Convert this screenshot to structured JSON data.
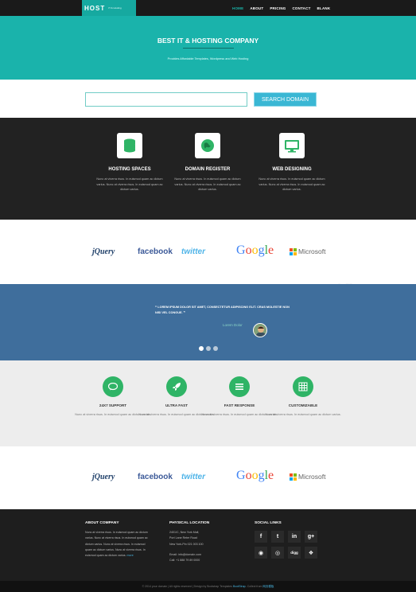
{
  "colors": {
    "accent": "#1ab3ab",
    "dark": "#222222",
    "blue_band": "#3f6e9c",
    "green_icon": "#2fb466",
    "search_btn": "#3ab7d4"
  },
  "nav": {
    "logo": "HOST",
    "logo_tagline": "IT & Hosting",
    "items": [
      {
        "label": "HOME",
        "active": true
      },
      {
        "label": "ABOUT"
      },
      {
        "label": "PRICING"
      },
      {
        "label": "CONTACT"
      },
      {
        "label": "BLANK"
      }
    ]
  },
  "hero": {
    "title": "BEST IT & HOSTING COMPANY",
    "subtitle": "Provides Affordable Templates, Wordpress and Web Hosting"
  },
  "search": {
    "placeholder": "",
    "button": "SEARCH DOMAIN"
  },
  "services": [
    {
      "icon": "database-icon",
      "title": "HOSTING SPACES",
      "text": "Nunc at viverra risus. In euismod quam ac dictum varius. Nunc at viverra risus. In euismod quam ac dictum varius."
    },
    {
      "icon": "globe-icon",
      "title": "DOMAIN REGISTER",
      "text": "Nunc at viverra risus. In euismod quam ac dictum varius. Nunc at viverra risus. In euismod quam ac dictum varius."
    },
    {
      "icon": "monitor-icon",
      "title": "WEB DESIGNING",
      "text": "Nunc at viverra risus. In euismod quam ac dictum varius. Nunc at viverra risus. In euismod quam ac dictum varius."
    }
  ],
  "brands": [
    "jQuery",
    "facebook",
    "twitter",
    "Google",
    "Microsoft"
  ],
  "testimonial": {
    "quote": "LOREM IPSUM DOLOR SIT AMET, CONSECTETUR ADIPISCING ELIT. CRAS MOLESTIE NON NISI VEL CONGUE.",
    "name": "Lorem Dolor"
  },
  "features": [
    {
      "icon": "chat-icon",
      "title": "24X7 SUPPORT",
      "text": "Nunc at viverra risus. In euismod quam ac dictum varius."
    },
    {
      "icon": "rocket-icon",
      "title": "ULTRA FAST",
      "text": "Nunc at viverra risus. In euismod quam ac dictum varius."
    },
    {
      "icon": "list-icon",
      "title": "FAST RESPONSE",
      "text": "Nunc at viverra risus. In euismod quam ac dictum varius."
    },
    {
      "icon": "grid-icon",
      "title": "CUSTOMIZABLE",
      "text": "Nunc at viverra risus. In euismod quam ac dictum varius."
    }
  ],
  "footer": {
    "about_title": "ABOUT COMPANY",
    "about_text": "Nunc at viverra risus. In euismod quam ac dictum varius. Nunc at viverra risus. In euismod quam ac dictum varius. Nunc at viverra risus. In euismod quam ac dictum varius. Nunc at viverra risus. In euismod quam ac dictum varius.",
    "about_more": "more",
    "location_title": "PHYSICAL LOCATION",
    "location_lines": [
      "2401/C, New York Mall,",
      "Port Lane Reter Road",
      "New York-Pin 021 003 100"
    ],
    "email": "Email: info@domain.com",
    "call": "Call: +1 888 79 89 0000",
    "social_title": "SOCIAL LINKS",
    "social": [
      "facebook-icon",
      "twitter-icon",
      "linkedin-icon",
      "google-plus-icon",
      "github-icon",
      "dribbble-icon",
      "digg-icon",
      "dropbox-icon"
    ],
    "social_glyphs": [
      "f",
      "t",
      "in",
      "g+",
      "◉",
      "◎",
      "digg",
      "❖"
    ]
  },
  "copyright": {
    "text": "© 2014 your domain | All rights reserved | Design by Bootstrap Templates",
    "link": "BootStrap",
    "trail": " - Collect from",
    "link2": "网页模板"
  }
}
